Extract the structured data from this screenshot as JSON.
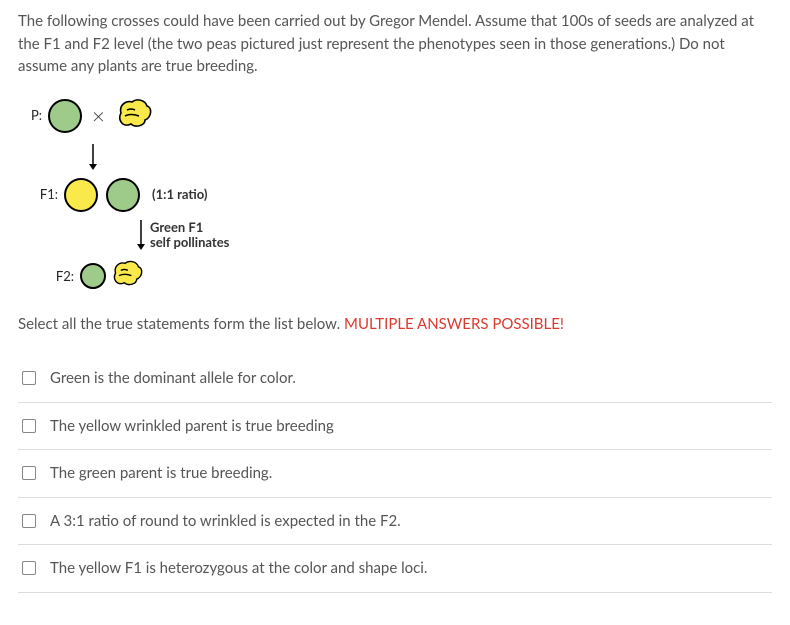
{
  "intro": "The following crosses could have been carried out by Gregor Mendel.  Assume that 100s of seeds are analyzed at the F1 and F2 level (the two peas pictured just represent the phenotypes seen in those generations.)  Do not assume any plants are true breeding.",
  "diagram": {
    "p_label": "P:",
    "cross_symbol": "×",
    "f1_label": "F1:",
    "f1_ratio": "(1:1 ratio)",
    "self_pollinates_line1": "Green F1",
    "self_pollinates_line2": "self pollinates",
    "f2_label": "F2:",
    "colors": {
      "green": "#9FCB8A",
      "yellow": "#FAE94A"
    }
  },
  "prompt_plain": "Select all the true statements form the list below.  ",
  "prompt_red": "MULTIPLE ANSWERS POSSIBLE!",
  "options": [
    "Green is the dominant allele for color.",
    "The yellow wrinkled parent is true breeding",
    "The green parent is true breeding.",
    "A 3:1 ratio of round to wrinkled is expected in the F2.",
    "The yellow F1 is heterozygous at the color and shape loci."
  ]
}
